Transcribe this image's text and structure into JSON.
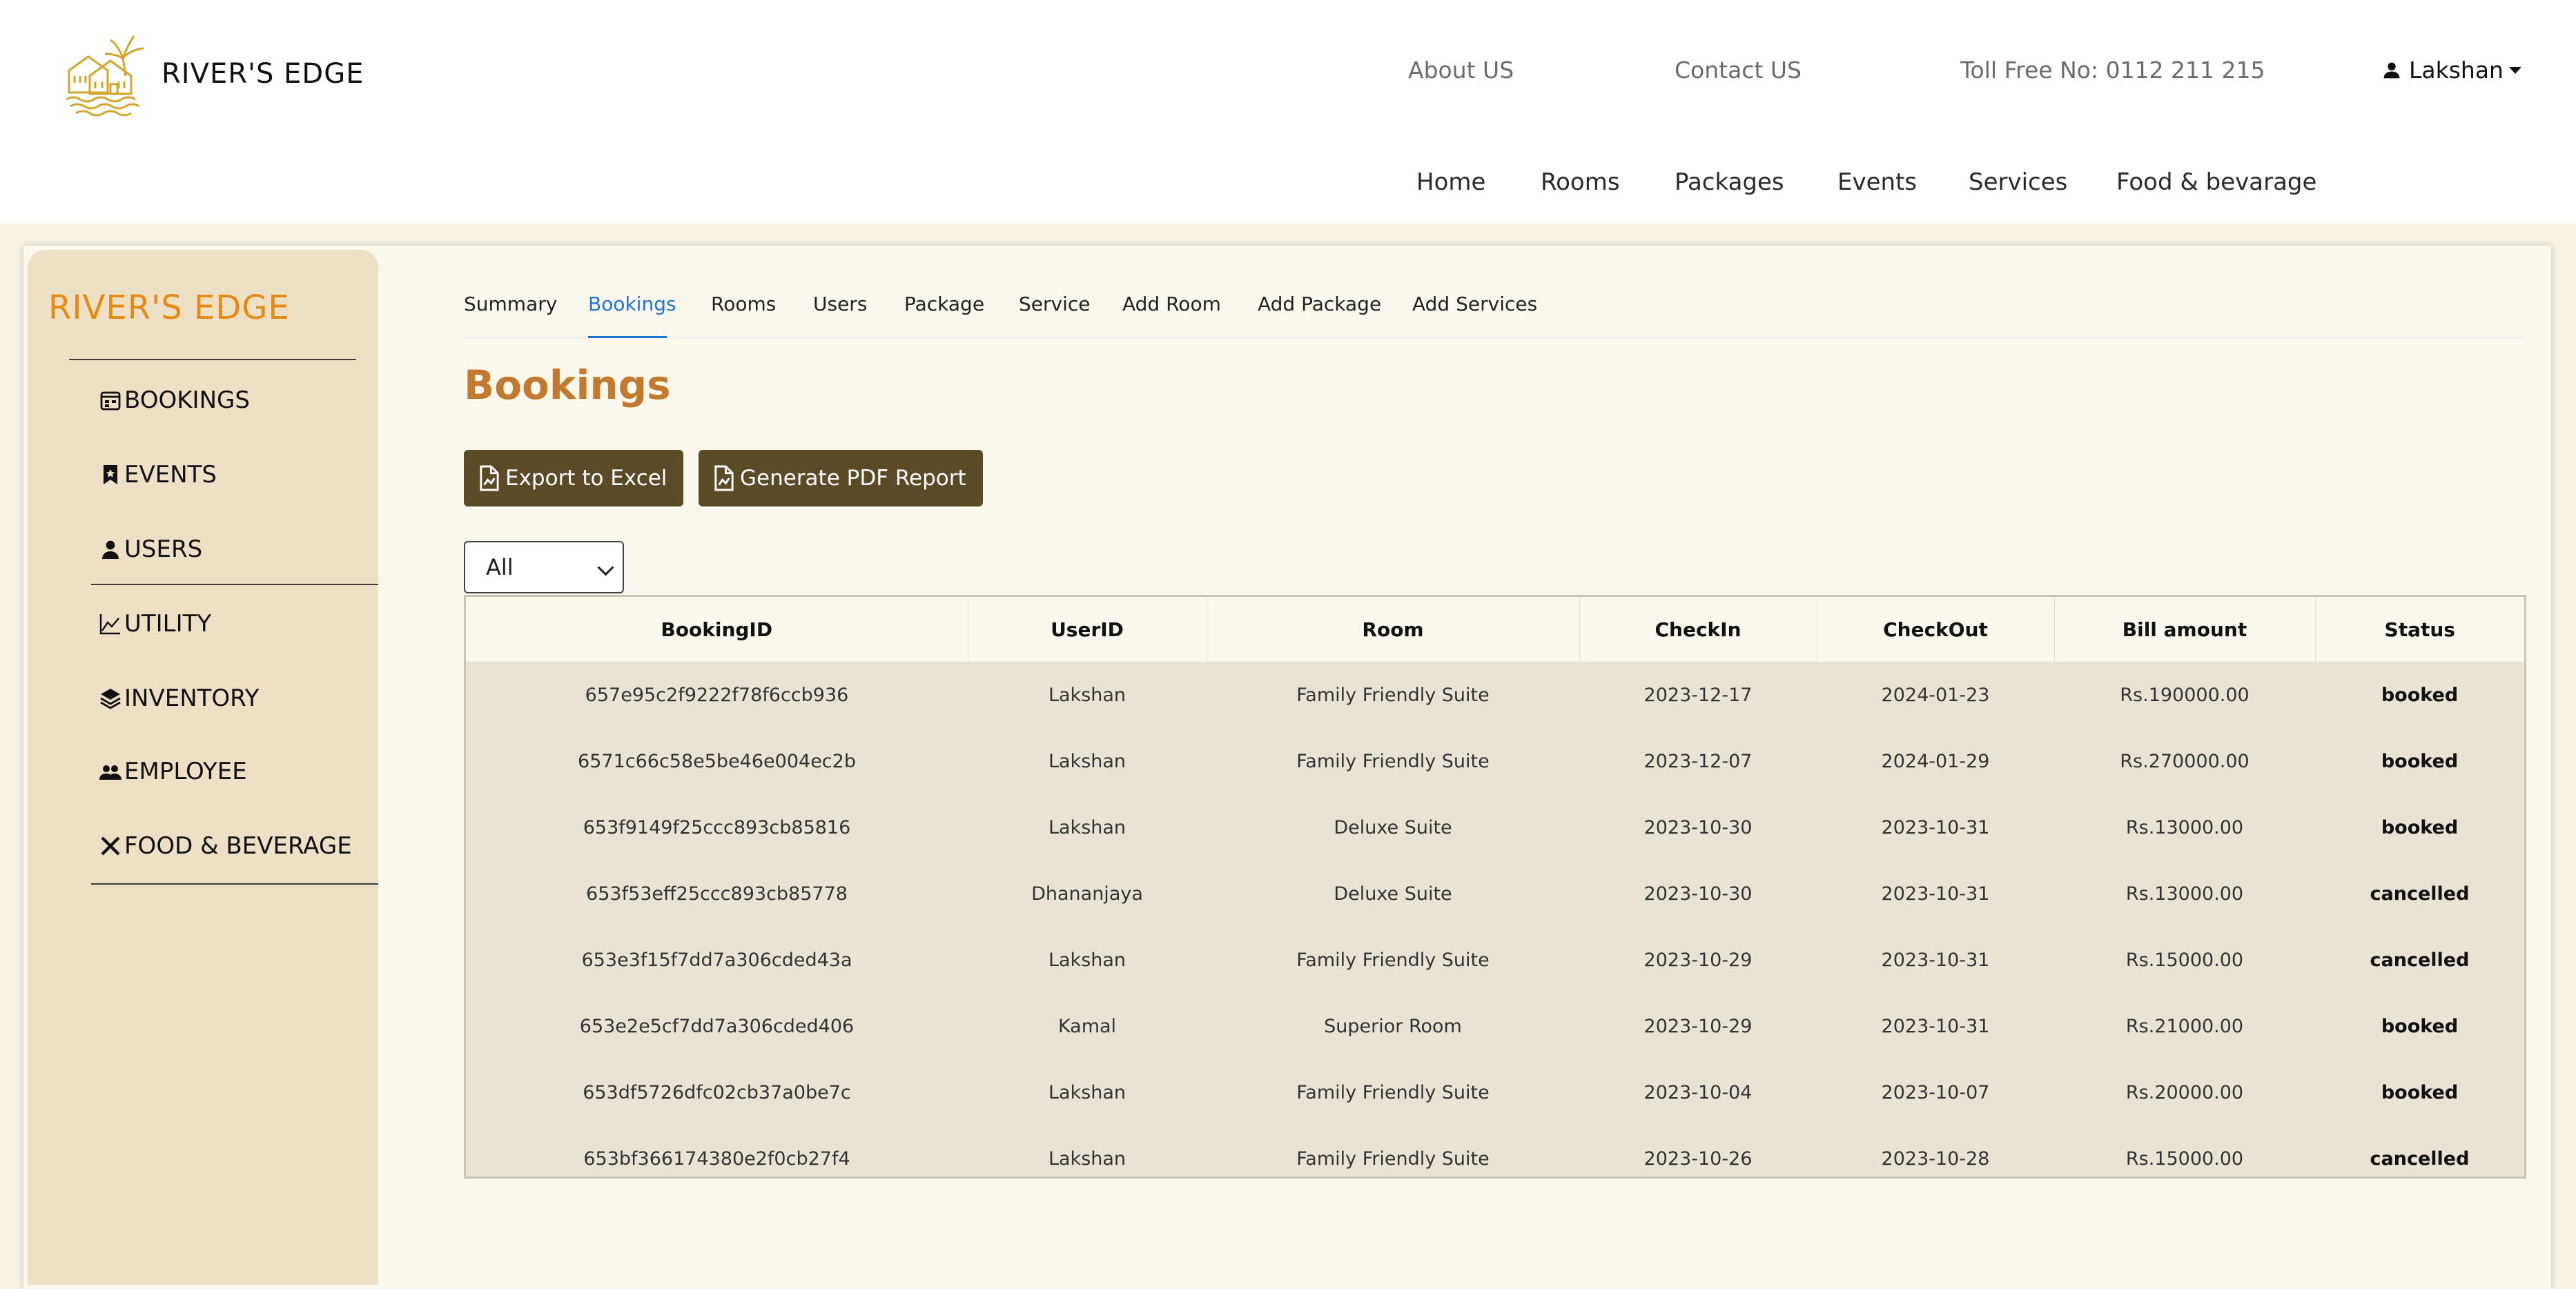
{
  "header": {
    "brand": "RIVER'S EDGE",
    "links": [
      "About US",
      "Contact US",
      "Toll Free No: 0112 211 215"
    ],
    "user": "Lakshan",
    "nav": [
      "Home",
      "Rooms",
      "Packages",
      "Events",
      "Services",
      "Food & bevarage"
    ]
  },
  "sidebar": {
    "title": "RIVER'S EDGE",
    "items": [
      {
        "label": "BOOKINGS",
        "icon": "calendar-icon"
      },
      {
        "label": "EVENTS",
        "icon": "bookmark-icon"
      },
      {
        "label": "USERS",
        "icon": "person-icon"
      },
      {
        "label": "UTILITY",
        "icon": "chart-icon"
      },
      {
        "label": "INVENTORY",
        "icon": "layers-icon"
      },
      {
        "label": "EMPLOYEE",
        "icon": "people-icon"
      },
      {
        "label": "FOOD & BEVERAGE",
        "icon": "utensils-icon"
      }
    ]
  },
  "tabs": [
    "Summary",
    "Bookings",
    "Rooms",
    "Users",
    "Package",
    "Service",
    "Add Room",
    "Add Package",
    "Add Services"
  ],
  "active_tab": "Bookings",
  "main": {
    "title": "Bookings",
    "export_label": "Export to Excel",
    "pdf_label": "Generate PDF Report",
    "filter_value": "All"
  },
  "table": {
    "columns": [
      "BookingID",
      "UserID",
      "Room",
      "CheckIn",
      "CheckOut",
      "Bill amount",
      "Status"
    ],
    "rows": [
      [
        "657e95c2f9222f78f6ccb936",
        "Lakshan",
        "Family Friendly Suite",
        "2023-12-17",
        "2024-01-23",
        "Rs.190000.00",
        "booked"
      ],
      [
        "6571c66c58e5be46e004ec2b",
        "Lakshan",
        "Family Friendly Suite",
        "2023-12-07",
        "2024-01-29",
        "Rs.270000.00",
        "booked"
      ],
      [
        "653f9149f25ccc893cb85816",
        "Lakshan",
        "Deluxe Suite",
        "2023-10-30",
        "2023-10-31",
        "Rs.13000.00",
        "booked"
      ],
      [
        "653f53eff25ccc893cb85778",
        "Dhananjaya",
        "Deluxe Suite",
        "2023-10-30",
        "2023-10-31",
        "Rs.13000.00",
        "cancelled"
      ],
      [
        "653e3f15f7dd7a306cded43a",
        "Lakshan",
        "Family Friendly Suite",
        "2023-10-29",
        "2023-10-31",
        "Rs.15000.00",
        "cancelled"
      ],
      [
        "653e2e5cf7dd7a306cded406",
        "Kamal",
        "Superior Room",
        "2023-10-29",
        "2023-10-31",
        "Rs.21000.00",
        "booked"
      ],
      [
        "653df5726dfc02cb37a0be7c",
        "Lakshan",
        "Family Friendly Suite",
        "2023-10-04",
        "2023-10-07",
        "Rs.20000.00",
        "booked"
      ],
      [
        "653bf366174380e2f0cb27f4",
        "Lakshan",
        "Family Friendly Suite",
        "2023-10-26",
        "2023-10-28",
        "Rs.15000.00",
        "cancelled"
      ]
    ]
  },
  "colors": {
    "accent_orange": "#e58a14",
    "title_brown": "#c27a2f",
    "button_brown": "#5b4a26",
    "active_tab_blue": "#1e73d6",
    "sidebar_bg": "#ede0c4",
    "page_bg": "#f7f2e3",
    "logo_gold": "#d4a52a"
  }
}
